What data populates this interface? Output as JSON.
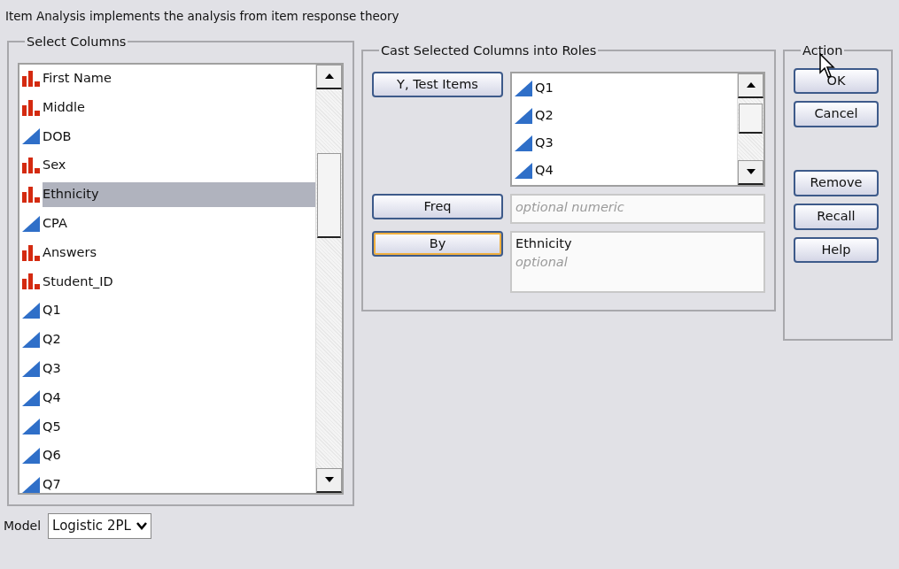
{
  "description": "Item Analysis implements the analysis from item response theory",
  "select_columns": {
    "title": "Select Columns",
    "items": [
      {
        "label": "First Name",
        "kind": "nominal",
        "selected": false
      },
      {
        "label": "Middle",
        "kind": "nominal",
        "selected": false
      },
      {
        "label": "DOB",
        "kind": "continuous",
        "selected": false
      },
      {
        "label": "Sex",
        "kind": "nominal",
        "selected": false
      },
      {
        "label": "Ethnicity",
        "kind": "nominal",
        "selected": true
      },
      {
        "label": "CPA",
        "kind": "continuous",
        "selected": false
      },
      {
        "label": "Answers",
        "kind": "nominal",
        "selected": false
      },
      {
        "label": "Student_ID",
        "kind": "nominal",
        "selected": false
      },
      {
        "label": "Q1",
        "kind": "continuous",
        "selected": false
      },
      {
        "label": "Q2",
        "kind": "continuous",
        "selected": false
      },
      {
        "label": "Q3",
        "kind": "continuous",
        "selected": false
      },
      {
        "label": "Q4",
        "kind": "continuous",
        "selected": false
      },
      {
        "label": "Q5",
        "kind": "continuous",
        "selected": false
      },
      {
        "label": "Q6",
        "kind": "continuous",
        "selected": false
      },
      {
        "label": "Q7",
        "kind": "continuous",
        "selected": false
      }
    ]
  },
  "roles": {
    "title": "Cast Selected Columns into Roles",
    "rows": [
      {
        "button": "Y, Test Items",
        "focused": false,
        "kind": "list",
        "items": [
          {
            "label": "Q1",
            "kind": "continuous"
          },
          {
            "label": "Q2",
            "kind": "continuous"
          },
          {
            "label": "Q3",
            "kind": "continuous"
          },
          {
            "label": "Q4",
            "kind": "continuous"
          }
        ]
      },
      {
        "button": "Freq",
        "focused": false,
        "kind": "field",
        "placeholder": "optional numeric"
      },
      {
        "button": "By",
        "focused": true,
        "kind": "list",
        "value": "Ethnicity",
        "placeholder": "optional"
      }
    ]
  },
  "action": {
    "title": "Action",
    "groups": [
      [
        "OK",
        "Cancel"
      ],
      [
        "Remove",
        "Recall",
        "Help"
      ]
    ]
  },
  "model": {
    "label": "Model",
    "value": "Logistic 2PL"
  }
}
